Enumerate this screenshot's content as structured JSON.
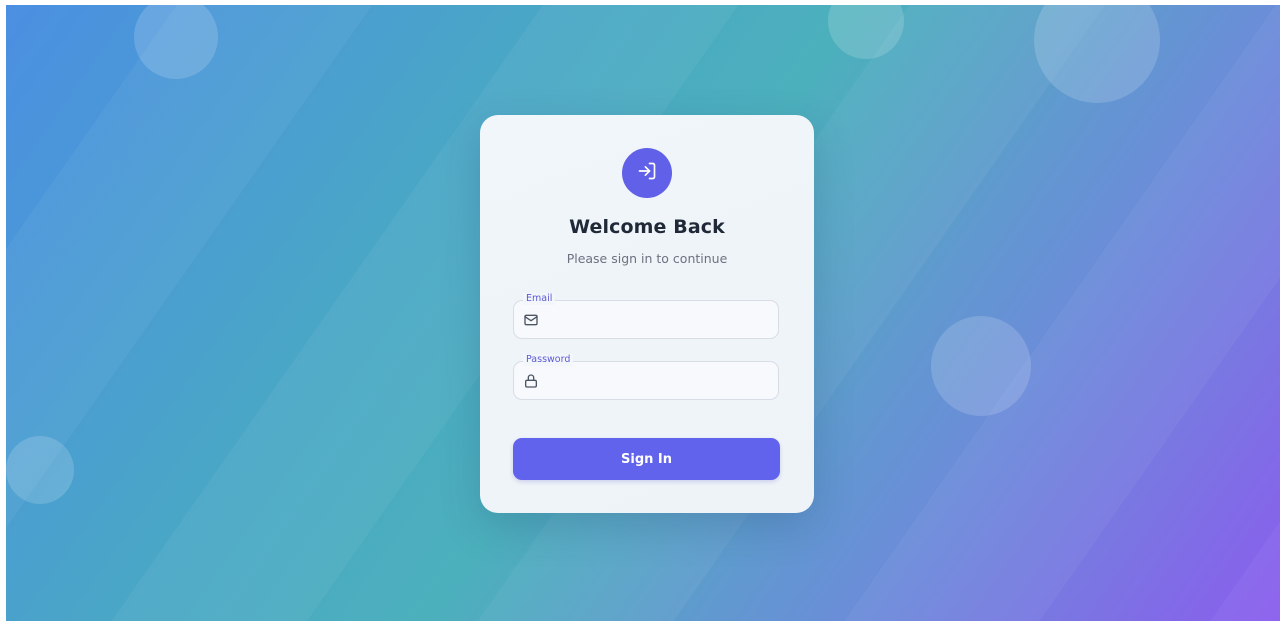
{
  "login": {
    "title": "Welcome Back",
    "subtitle": "Please sign in to continue",
    "logo_icon": "sign-in-icon",
    "email": {
      "label": "Email",
      "value": "",
      "icon": "mail-icon"
    },
    "password": {
      "label": "Password",
      "value": "",
      "icon": "lock-icon"
    },
    "submit_label": "Sign In"
  },
  "colors": {
    "accent": "#6163ec",
    "title_text": "#1f2937",
    "subtitle_text": "#6b7280",
    "background_start": "#4b8fe2",
    "background_mid": "#4cb0bc",
    "background_end": "#8a5ded"
  }
}
